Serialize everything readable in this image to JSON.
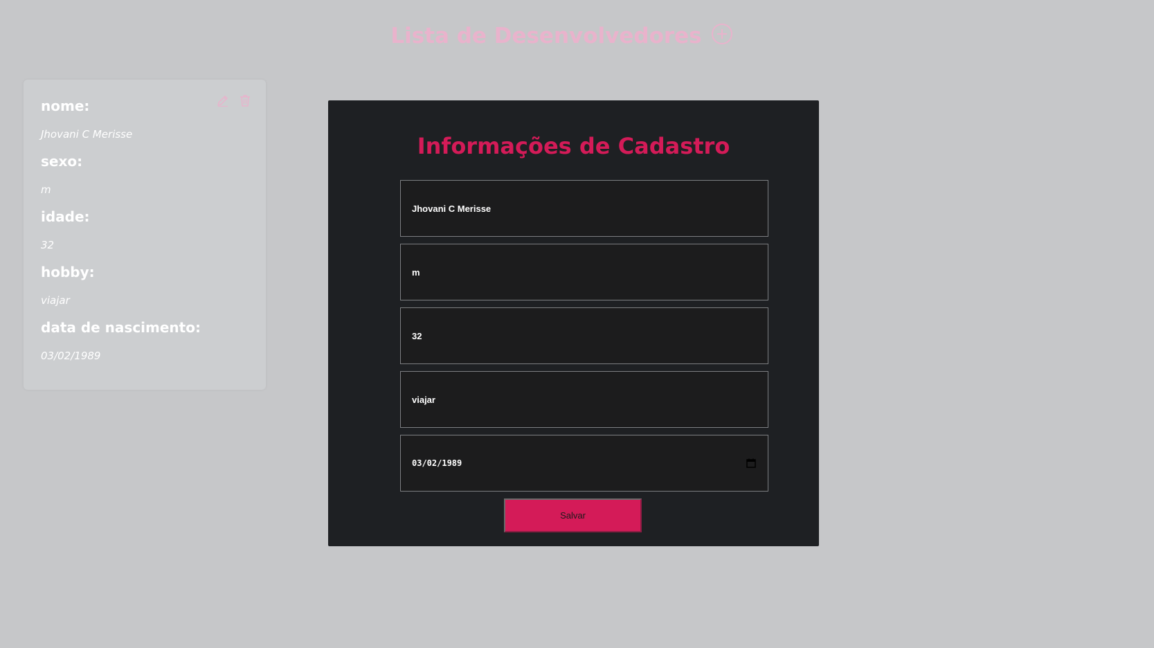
{
  "header": {
    "title": "Lista de Desenvolvedores",
    "add_icon": "plus-circle-icon"
  },
  "card": {
    "icons": [
      "pencil-icon",
      "trash-icon"
    ],
    "fields": [
      {
        "label": "nome:",
        "value": "Jhovani C Merisse"
      },
      {
        "label": "sexo:",
        "value": "m"
      },
      {
        "label": "idade:",
        "value": "32"
      },
      {
        "label": "hobby:",
        "value": "viajar"
      },
      {
        "label": "data de nascimento:",
        "value": "03/02/1989"
      }
    ]
  },
  "form": {
    "title": "Informações de Cadastro",
    "nome_value": "Jhovani C Merisse",
    "sexo_value": "m",
    "idade_value": "32",
    "hobby_value": "viajar",
    "data_nascimento_value": "03/02/1989",
    "save_label": "Salvar"
  },
  "colors": {
    "background": "#c6c7c9",
    "accent": "#d41b58",
    "header_text": "#e9b3cc",
    "modal_background": "#1e2023"
  }
}
